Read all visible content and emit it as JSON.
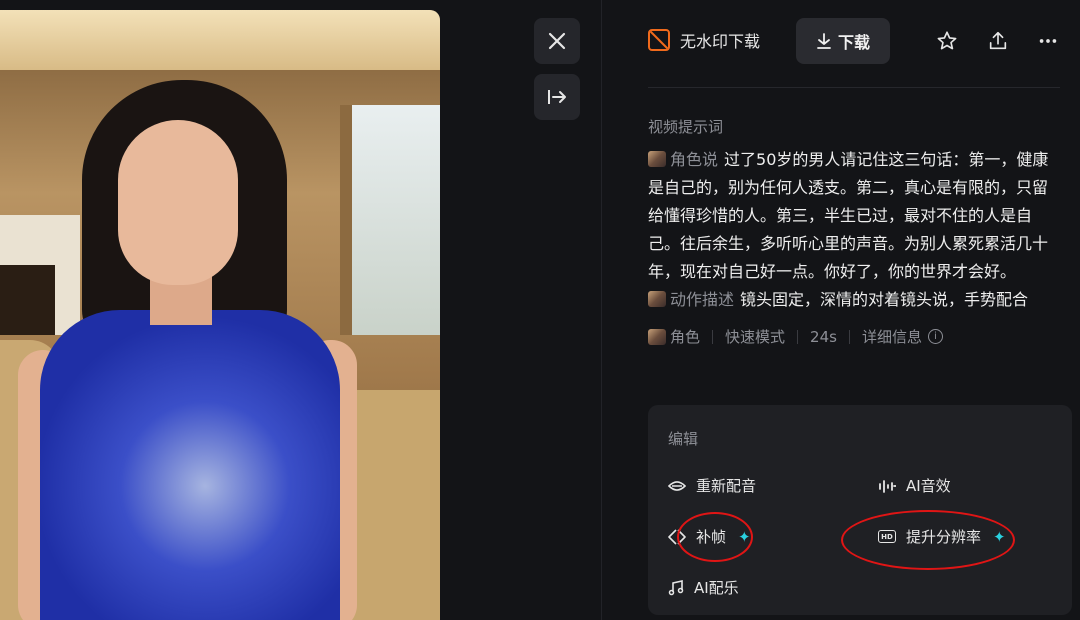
{
  "toolbar": {
    "close_icon": "close-icon",
    "collapse_icon": "arrow-right-bar-icon"
  },
  "topbar": {
    "no_watermark_label": "无水印下载",
    "download_label": "下载",
    "icons": [
      "star-icon",
      "share-icon",
      "more-icon"
    ]
  },
  "prompt": {
    "title": "视频提示词",
    "role_tag": "角色说",
    "role_text": "过了50岁的男人请记住这三句话：第一，健康是自己的，别为任何人透支。第二，真心是有限的，只留给懂得珍惜的人。第三，半生已过，最对不住的人是自己。往后余生，多听听心里的声音。为别人累死累活几十年，现在对自己好一点。你好了，你的世界才会好。",
    "action_tag": "动作描述",
    "action_text": "镜头固定，深情的对着镜头说，手势配合"
  },
  "meta": {
    "role": "角色",
    "mode": "快速模式",
    "duration": "24s",
    "details": "详细信息"
  },
  "edit": {
    "title": "编辑",
    "redub": "重新配音",
    "ai_sfx": "AI音效",
    "frame_interp": "补帧",
    "upscale": "提升分辨率",
    "ai_music": "AI配乐"
  },
  "colors": {
    "accent_orange": "#f06a1c",
    "sparkle": "#2ad1e0",
    "annotation_red": "#e01515"
  }
}
